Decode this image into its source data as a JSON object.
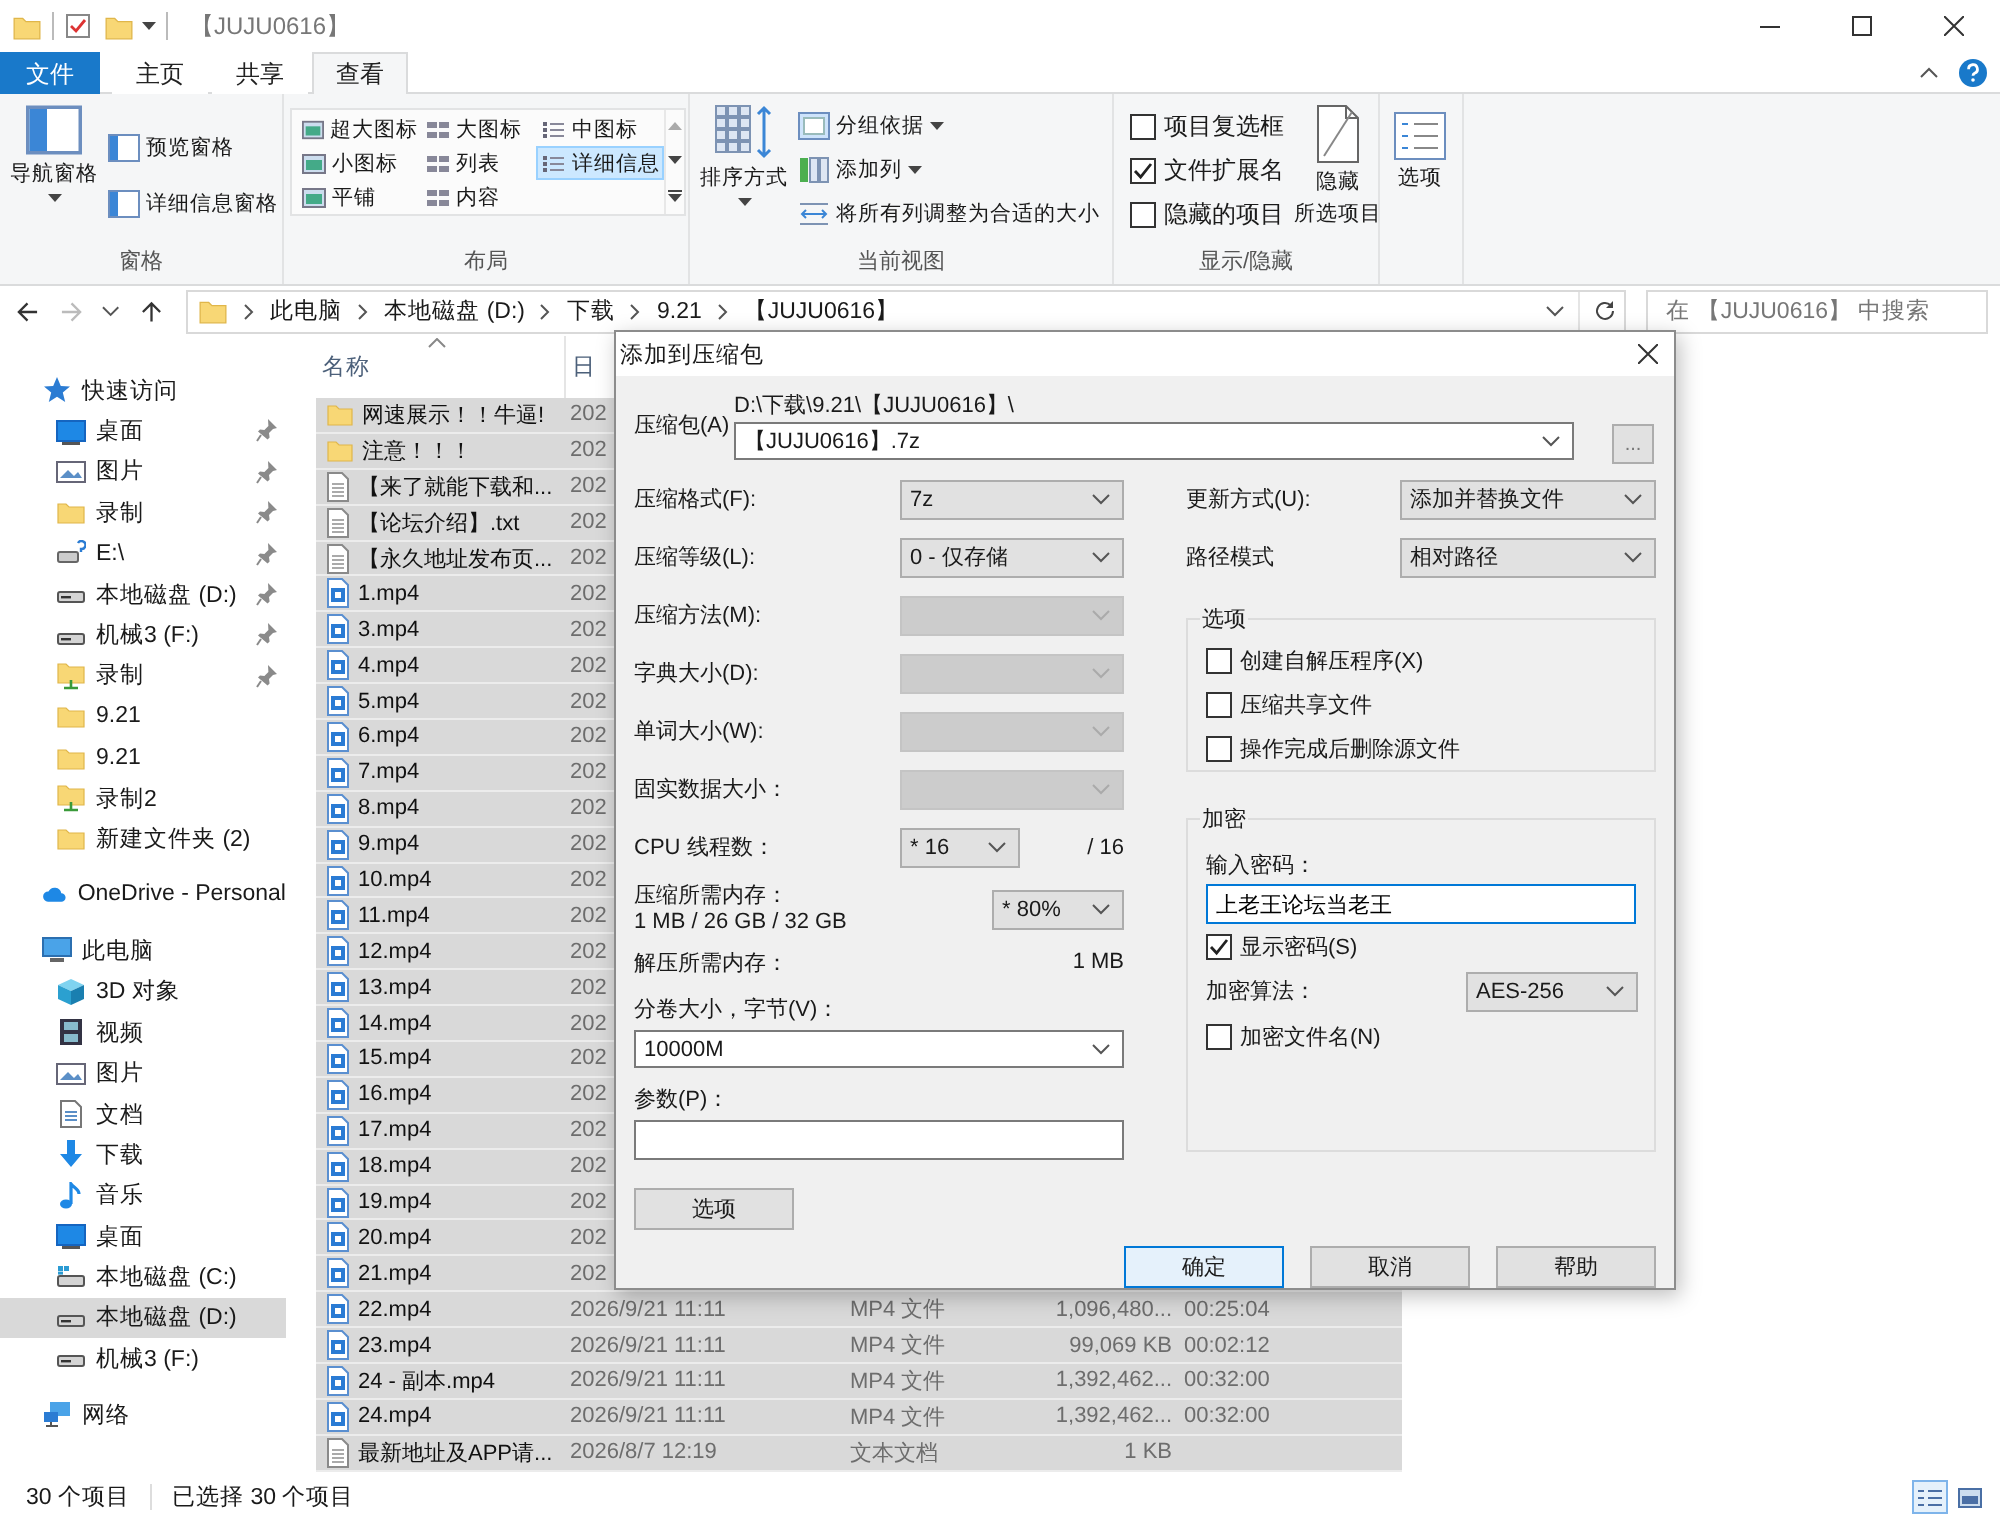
{
  "window": {
    "title": "【JUJU0616】"
  },
  "ribbon": {
    "tabs": [
      {
        "label": "文件",
        "kind": "file",
        "selected": false
      },
      {
        "label": "主页",
        "kind": "tab",
        "selected": false
      },
      {
        "label": "共享",
        "kind": "tab",
        "selected": false
      },
      {
        "label": "查看",
        "kind": "tab",
        "selected": true
      }
    ],
    "panes": {
      "label": "窗格",
      "navigation": "导航窗格",
      "buttons": [
        "预览窗格",
        "详细信息窗格"
      ]
    },
    "layout": {
      "label": "布局",
      "options": [
        {
          "label": "超大图标",
          "selected": false
        },
        {
          "label": "大图标",
          "selected": false
        },
        {
          "label": "中图标",
          "selected": false
        },
        {
          "label": "小图标",
          "selected": false
        },
        {
          "label": "列表",
          "selected": false
        },
        {
          "label": "详细信息",
          "selected": true
        },
        {
          "label": "平铺",
          "selected": false
        },
        {
          "label": "内容",
          "selected": false
        }
      ]
    },
    "current_view": {
      "label": "当前视图",
      "sort": "排序方式",
      "buttons": [
        "分组依据",
        "添加列",
        "将所有列调整为合适的大小"
      ]
    },
    "show_hide": {
      "label": "显示/隐藏",
      "checkboxes": [
        {
          "label": "项目复选框",
          "checked": false
        },
        {
          "label": "文件扩展名",
          "checked": true
        },
        {
          "label": "隐藏的项目",
          "checked": false
        }
      ],
      "hide_selected": [
        "隐藏",
        "所选项目"
      ]
    },
    "options": "选项"
  },
  "address_bar": {
    "breadcrumbs": [
      "此电脑",
      "本地磁盘 (D:)",
      "下载",
      "9.21",
      "【JUJU0616】"
    ],
    "search_placeholder": "在 【JUJU0616】 中搜索"
  },
  "sidebar": {
    "sections": [
      {
        "label": "快速访问",
        "kind": "quick",
        "selected": false,
        "children": [
          {
            "label": "桌面",
            "kind": "desktop",
            "pinned": true,
            "selected": false
          },
          {
            "label": "图片",
            "kind": "pictures",
            "pinned": true,
            "selected": false
          },
          {
            "label": "录制",
            "kind": "folder",
            "pinned": true,
            "selected": false
          },
          {
            "label": "E:\\",
            "kind": "netdrive",
            "pinned": true,
            "selected": false
          },
          {
            "label": "本地磁盘 (D:)",
            "kind": "drive",
            "pinned": true,
            "selected": false
          },
          {
            "label": "机械3 (F:)",
            "kind": "drive",
            "pinned": true,
            "selected": false
          },
          {
            "label": "录制",
            "kind": "shared",
            "pinned": true,
            "selected": false
          },
          {
            "label": "9.21",
            "kind": "folder",
            "pinned": false,
            "selected": false
          },
          {
            "label": "9.21",
            "kind": "folder",
            "pinned": false,
            "selected": false
          },
          {
            "label": "录制2",
            "kind": "shared",
            "pinned": false,
            "selected": false
          },
          {
            "label": "新建文件夹 (2)",
            "kind": "folder",
            "pinned": false,
            "selected": false
          }
        ]
      },
      {
        "label": "OneDrive - Personal",
        "kind": "cloud",
        "selected": false
      },
      {
        "label": "此电脑",
        "kind": "pc",
        "selected": false,
        "children": [
          {
            "label": "3D 对象",
            "kind": "cube",
            "selected": false
          },
          {
            "label": "视频",
            "kind": "video",
            "selected": false
          },
          {
            "label": "图片",
            "kind": "pictures",
            "selected": false
          },
          {
            "label": "文档",
            "kind": "document",
            "selected": false
          },
          {
            "label": "下载",
            "kind": "download",
            "selected": false
          },
          {
            "label": "音乐",
            "kind": "music",
            "selected": false
          },
          {
            "label": "桌面",
            "kind": "desktop",
            "selected": false
          },
          {
            "label": "本地磁盘 (C:)",
            "kind": "windrive",
            "selected": false
          },
          {
            "label": "本地磁盘 (D:)",
            "kind": "drive",
            "selected": true
          },
          {
            "label": "机械3 (F:)",
            "kind": "drive",
            "selected": false
          }
        ]
      },
      {
        "label": "网络",
        "kind": "network",
        "selected": false
      }
    ]
  },
  "files": {
    "columns": [
      "名称",
      "日"
    ],
    "rows": [
      {
        "name": "网速展示！！牛逼!",
        "kind": "folder",
        "date": "202",
        "selected": true
      },
      {
        "name": "注意！！！",
        "kind": "folder",
        "date": "202",
        "selected": true
      },
      {
        "name": "【来了就能下载和...",
        "kind": "text",
        "date": "202",
        "selected": true
      },
      {
        "name": "【论坛介绍】.txt",
        "kind": "text",
        "date": "202",
        "selected": true
      },
      {
        "name": "【永久地址发布页...",
        "kind": "text",
        "date": "202",
        "selected": true
      },
      {
        "name": "1.mp4",
        "kind": "video",
        "date": "202",
        "selected": true
      },
      {
        "name": "3.mp4",
        "kind": "video",
        "date": "202",
        "selected": true
      },
      {
        "name": "4.mp4",
        "kind": "video",
        "date": "202",
        "selected": true
      },
      {
        "name": "5.mp4",
        "kind": "video",
        "date": "202",
        "selected": true
      },
      {
        "name": "6.mp4",
        "kind": "video",
        "date": "202",
        "selected": true
      },
      {
        "name": "7.mp4",
        "kind": "video",
        "date": "202",
        "selected": true
      },
      {
        "name": "8.mp4",
        "kind": "video",
        "date": "202",
        "selected": true
      },
      {
        "name": "9.mp4",
        "kind": "video",
        "date": "202",
        "selected": true
      },
      {
        "name": "10.mp4",
        "kind": "video",
        "date": "202",
        "selected": true
      },
      {
        "name": "11.mp4",
        "kind": "video",
        "date": "202",
        "selected": true
      },
      {
        "name": "12.mp4",
        "kind": "video",
        "date": "202",
        "selected": true
      },
      {
        "name": "13.mp4",
        "kind": "video",
        "date": "202",
        "selected": true
      },
      {
        "name": "14.mp4",
        "kind": "video",
        "date": "202",
        "selected": true
      },
      {
        "name": "15.mp4",
        "kind": "video",
        "date": "202",
        "selected": true
      },
      {
        "name": "16.mp4",
        "kind": "video",
        "date": "202",
        "selected": true
      },
      {
        "name": "17.mp4",
        "kind": "video",
        "date": "202",
        "selected": true
      },
      {
        "name": "18.mp4",
        "kind": "video",
        "date": "202",
        "selected": true
      },
      {
        "name": "19.mp4",
        "kind": "video",
        "date": "202",
        "selected": true
      },
      {
        "name": "20.mp4",
        "kind": "video",
        "date": "202",
        "selected": true
      },
      {
        "name": "21.mp4",
        "kind": "video",
        "date": "202",
        "selected": true
      },
      {
        "name": "22.mp4",
        "kind": "video",
        "date": "2026/9/21 11:11",
        "type": "MP4 文件",
        "size": "1,096,480...",
        "duration": "00:25:04",
        "selected": true
      },
      {
        "name": "23.mp4",
        "kind": "video",
        "date": "2026/9/21 11:11",
        "type": "MP4 文件",
        "size": "99,069 KB",
        "duration": "00:02:12",
        "selected": true
      },
      {
        "name": "24 - 副本.mp4",
        "kind": "video",
        "date": "2026/9/21 11:11",
        "type": "MP4 文件",
        "size": "1,392,462...",
        "duration": "00:32:00",
        "selected": true
      },
      {
        "name": "24.mp4",
        "kind": "video",
        "date": "2026/9/21 11:11",
        "type": "MP4 文件",
        "size": "1,392,462...",
        "duration": "00:32:00",
        "selected": true
      },
      {
        "name": "最新地址及APP请...",
        "kind": "text",
        "date": "2026/8/7 12:19",
        "type": "文本文档",
        "size": "1 KB",
        "selected": true
      }
    ]
  },
  "dialog": {
    "title": "添加到压缩包",
    "archive": {
      "label": "压缩包(A)",
      "folder": "D:\\下载\\9.21\\【JUJU0616】\\",
      "name": "【JUJU0616】.7z",
      "browse": "..."
    },
    "left": [
      {
        "kind": "select",
        "label": "压缩格式(F):",
        "value": "7z",
        "disabled": false
      },
      {
        "kind": "select",
        "label": "压缩等级(L):",
        "value": "0 - 仅存储",
        "disabled": false
      },
      {
        "kind": "select",
        "label": "压缩方法(M):",
        "disabled": true
      },
      {
        "kind": "select",
        "label": "字典大小(D):",
        "disabled": true
      },
      {
        "kind": "select",
        "label": "单词大小(W):",
        "disabled": true
      },
      {
        "kind": "select",
        "label": "固实数据大小：",
        "disabled": true
      },
      {
        "kind": "threads",
        "label": "CPU 线程数：",
        "value": "* 16",
        "total": "/ 16"
      },
      {
        "kind": "memory",
        "label": "压缩所需内存：",
        "detail": "1 MB / 26 GB / 32 GB",
        "value": "* 80%"
      },
      {
        "kind": "info",
        "label": "解压所需内存：",
        "value": "1 MB"
      },
      {
        "kind": "combo",
        "label": "分卷大小，字节(V)：",
        "value": "10000M"
      },
      {
        "kind": "input",
        "label": "参数(P)："
      }
    ],
    "options_button": "选项",
    "right": {
      "selects": [
        {
          "label": "更新方式(U):",
          "value": "添加并替换文件"
        },
        {
          "label": "路径模式",
          "value": "相对路径"
        }
      ],
      "options": {
        "title": "选项",
        "checkboxes": [
          {
            "label": "创建自解压程序(X)",
            "checked": false
          },
          {
            "label": "压缩共享文件",
            "checked": false
          },
          {
            "label": "操作完成后删除源文件",
            "checked": false
          }
        ]
      },
      "encryption": {
        "title": "加密",
        "password_label": "输入密码：",
        "password": "上老王论坛当老王",
        "show_password": {
          "label": "显示密码(S)",
          "checked": true
        },
        "method_label": "加密算法：",
        "method": "AES-256",
        "encrypt_names": {
          "label": "加密文件名(N)",
          "checked": false
        }
      }
    },
    "buttons": [
      {
        "label": "确定",
        "default": true
      },
      {
        "label": "取消",
        "default": false
      },
      {
        "label": "帮助",
        "default": false
      }
    ]
  },
  "status_bar": {
    "count": "30 个项目",
    "selection": "已选择 30 个项目",
    "views": [
      {
        "kind": "details",
        "selected": true
      },
      {
        "kind": "large",
        "selected": false
      }
    ]
  }
}
